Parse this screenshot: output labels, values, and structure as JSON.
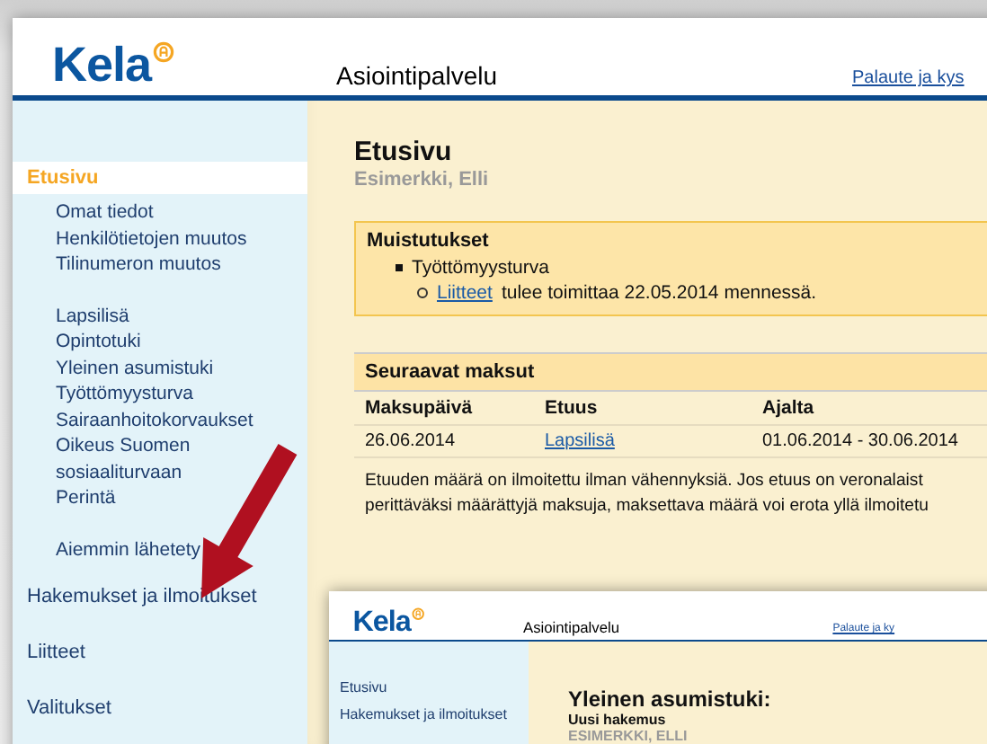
{
  "main_window": {
    "header": {
      "logo": "Kela",
      "title": "Asiointipalvelu",
      "feedback_link": "Palaute ja kys"
    },
    "sidebar": {
      "items": [
        {
          "label": "Etusivu",
          "selected": true,
          "groups": [
            [
              "Omat tiedot",
              "Henkilötietojen muutos",
              "Tilinumeron muutos"
            ],
            [
              "Lapsilisä",
              "Opintotuki",
              "Yleinen asumistuki",
              "Työttömyysturva",
              "Sairaanhoitokorvaukset",
              "Oikeus Suomen sosiaaliturvaan",
              "Perintä"
            ],
            [
              "Aiemmin lähetety"
            ]
          ]
        },
        {
          "label": "Hakemukset ja ilmoitukset",
          "selected": false
        },
        {
          "label": "Liitteet",
          "selected": false
        },
        {
          "label": "Valitukset",
          "selected": false
        }
      ]
    },
    "content": {
      "title": "Etusivu",
      "person": "Esimerkki, Elli",
      "reminders": {
        "title": "Muistutukset",
        "items": [
          {
            "label": "Työttömyysturva",
            "children": [
              {
                "link": "Liitteet",
                "text": "tulee toimittaa 22.05.2014 mennessä."
              }
            ]
          }
        ]
      },
      "payments": {
        "title": "Seuraavat maksut",
        "columns": [
          "Maksupäivä",
          "Etuus",
          "Ajalta"
        ],
        "rows": [
          [
            {
              "text": "26.06.2014",
              "link": false
            },
            {
              "text": "Lapsilisä",
              "link": true
            },
            {
              "text": "01.06.2014 - 30.06.2014",
              "link": false
            }
          ]
        ]
      },
      "note_lines": [
        "Etuuden määrä on ilmoitettu ilman vähennyksiä. Jos etuus on veronalaist",
        "perittäväksi määrättyjä maksuja, maksettava määrä voi erota yllä ilmoitetu"
      ]
    }
  },
  "second_window": {
    "header": {
      "logo": "Kela",
      "title": "Asiointipalvelu",
      "feedback_link": "Palaute ja ky"
    },
    "sidebar": {
      "items": [
        {
          "label": "Etusivu",
          "selected": false
        },
        {
          "label": "Hakemukset ja ilmoitukset",
          "selected": false
        }
      ]
    },
    "content": {
      "title": "Yleinen asumistuki:",
      "subtitle": "Uusi hakemus",
      "person": "ESIMERKKI, ELLI"
    }
  }
}
